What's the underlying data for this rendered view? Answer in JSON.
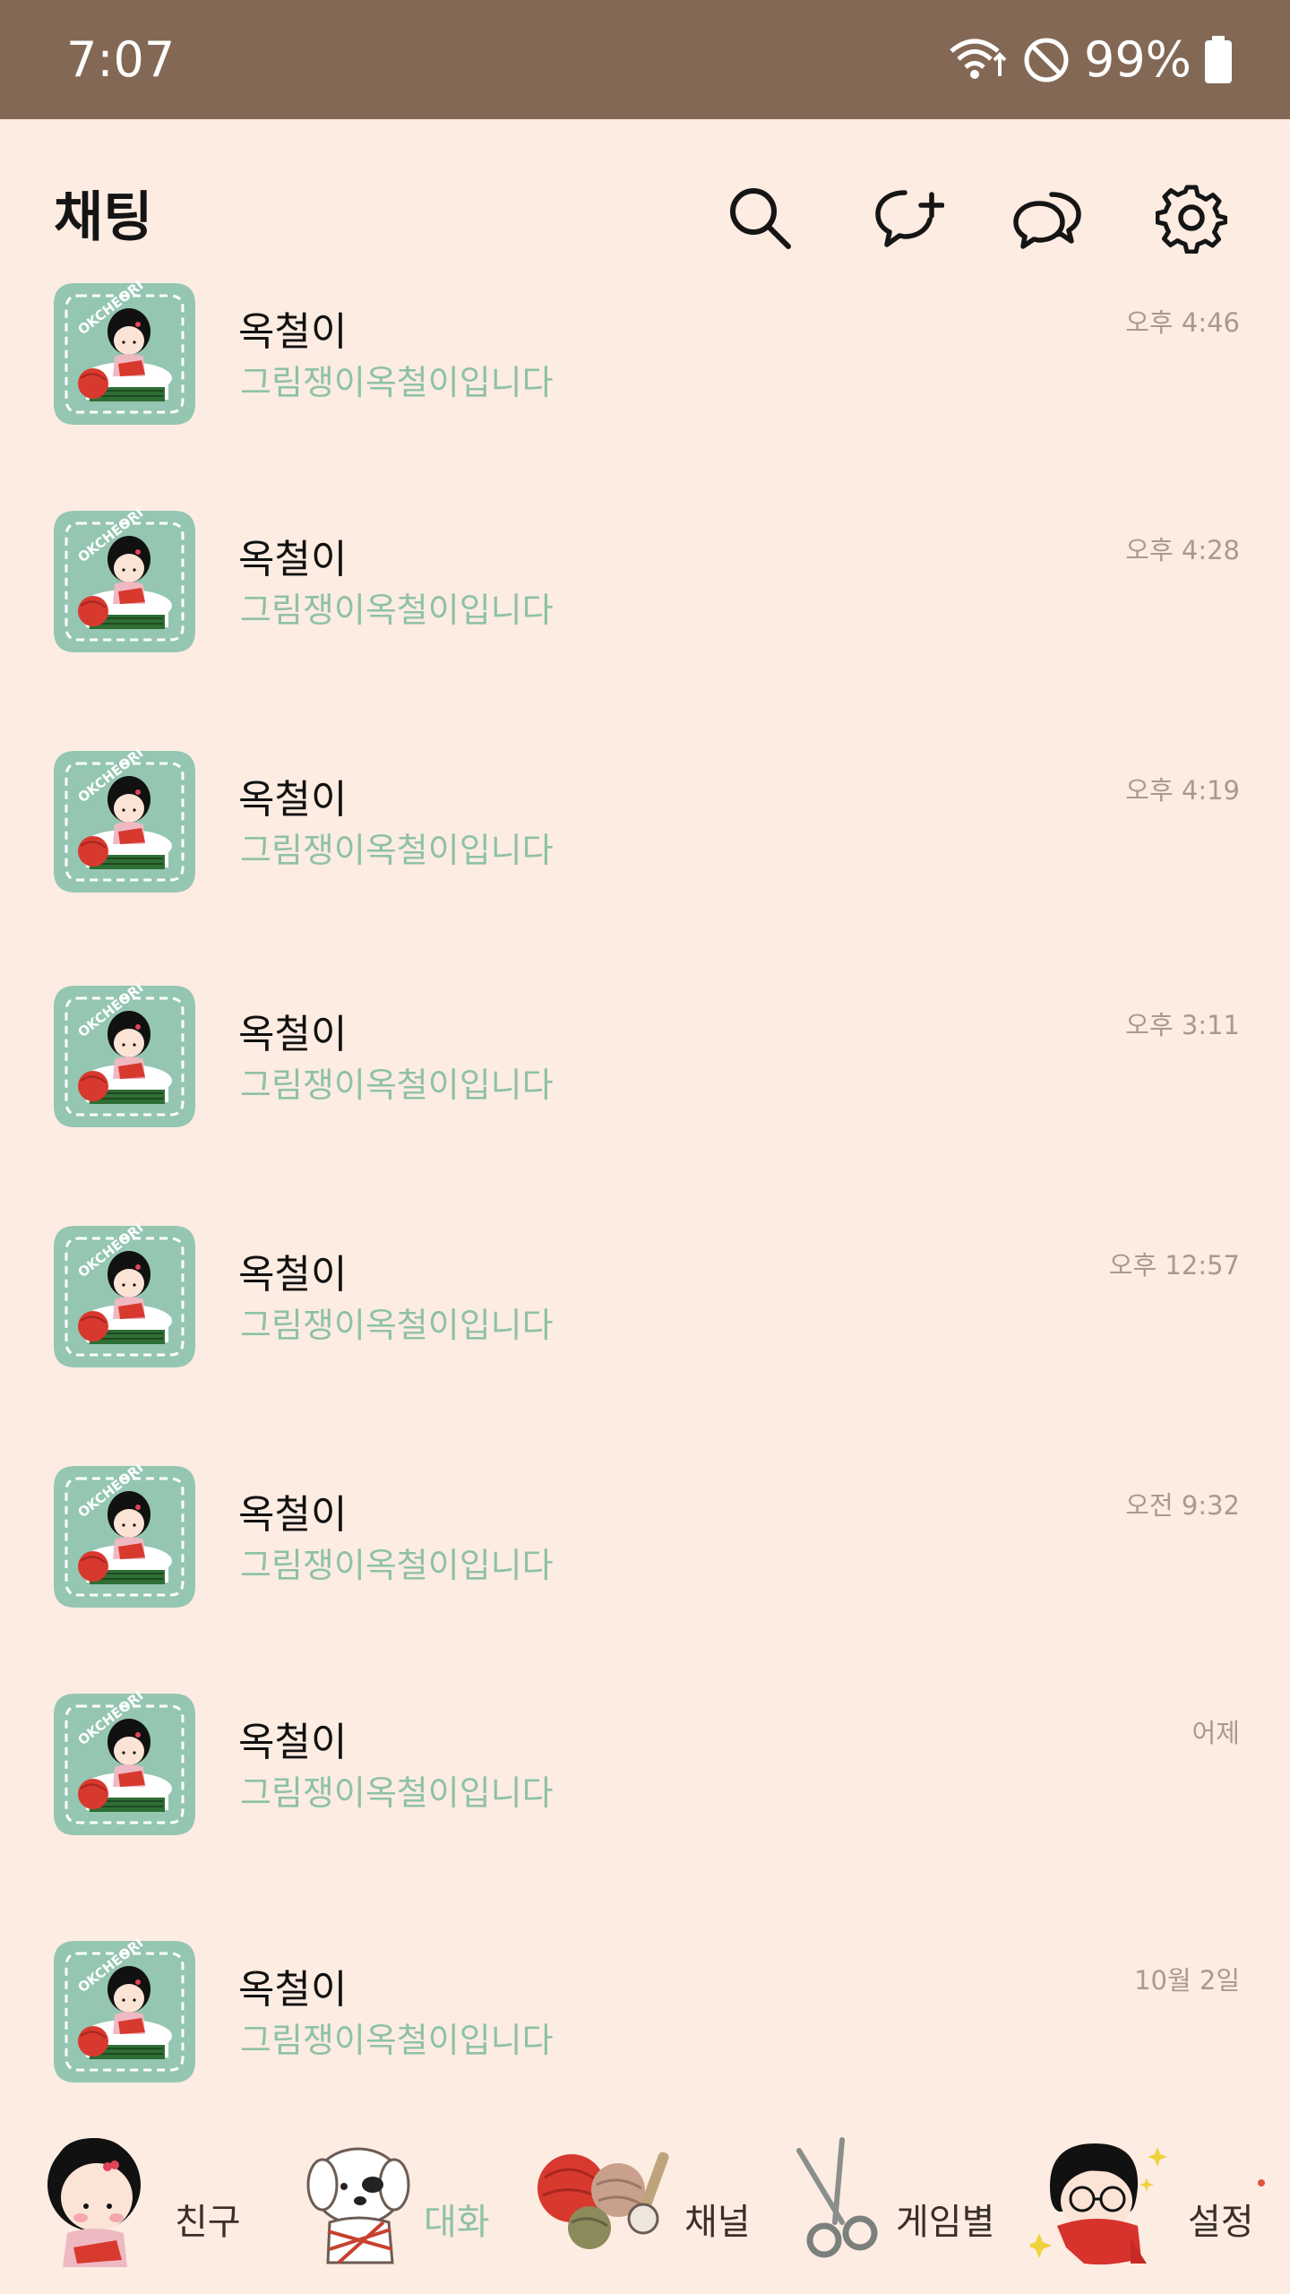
{
  "status_bar": {
    "time": "7:07",
    "battery_text": "99%",
    "icons": [
      "wifi-icon",
      "do-not-disturb-icon",
      "battery-icon"
    ]
  },
  "header": {
    "title": "채팅",
    "icons": [
      "search-icon",
      "new-chat-icon",
      "open-chat-icon",
      "settings-icon"
    ]
  },
  "chats": [
    {
      "name": "옥철이",
      "preview": "그림쟁이옥철이입니다",
      "time": "오후 4:46"
    },
    {
      "name": "옥철이",
      "preview": "그림쟁이옥철이입니다",
      "time": "오후 4:28"
    },
    {
      "name": "옥철이",
      "preview": "그림쟁이옥철이입니다",
      "time": "오후 4:19"
    },
    {
      "name": "옥철이",
      "preview": "그림쟁이옥철이입니다",
      "time": "오후 3:11"
    },
    {
      "name": "옥철이",
      "preview": "그림쟁이옥철이입니다",
      "time": "오후 12:57"
    },
    {
      "name": "옥철이",
      "preview": "그림쟁이옥철이입니다",
      "time": "오전 9:32"
    },
    {
      "name": "옥철이",
      "preview": "그림쟁이옥철이입니다",
      "time": "어제"
    },
    {
      "name": "옥철이",
      "preview": "그림쟁이옥철이입니다",
      "time": "10월 2일"
    }
  ],
  "avatar_badge_text": "OKCHEORI",
  "nav": {
    "friends": "친구",
    "chats": "대화",
    "channel": "채널",
    "games": "게임별",
    "settings": "설정",
    "active": "chats"
  },
  "colors": {
    "status_bar": "#836855",
    "background": "#fdece2",
    "preview_text": "#8ec2a5",
    "avatar_bg": "#94c6b2"
  }
}
